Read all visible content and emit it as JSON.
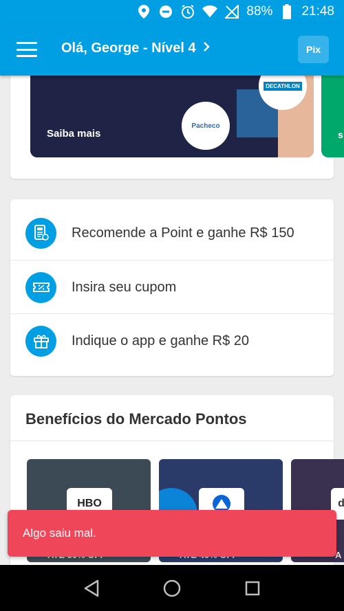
{
  "statusbar": {
    "battery": "88%",
    "time": "21:48"
  },
  "appbar": {
    "greeting": "Olá, George - Nível 4",
    "pix_label": "Pix"
  },
  "banner": {
    "cta": "Saiba mais",
    "logo_left": "Pacheco",
    "logo_right": "DECATHLON",
    "next_partial": "s"
  },
  "actions": [
    {
      "label": "Recomende a Point e ganhe R$ 150",
      "icon": "point-device-icon"
    },
    {
      "label": "Insira seu cupom",
      "icon": "coupon-icon"
    },
    {
      "label": "Indique o app e ganhe R$ 20",
      "icon": "gift-icon"
    }
  ],
  "benefits": {
    "title": "Benefícios do Mercado Pontos",
    "tiles": [
      {
        "logo": "HBO",
        "caption": "ATÉ 50% OFF"
      },
      {
        "logo": "paramount",
        "caption": "ATÉ 40% OFF"
      },
      {
        "logo": "d",
        "caption": "A"
      }
    ]
  },
  "toast": {
    "message": "Algo saiu mal."
  },
  "colors": {
    "brand": "#009ee3",
    "error": "#f0465a"
  }
}
